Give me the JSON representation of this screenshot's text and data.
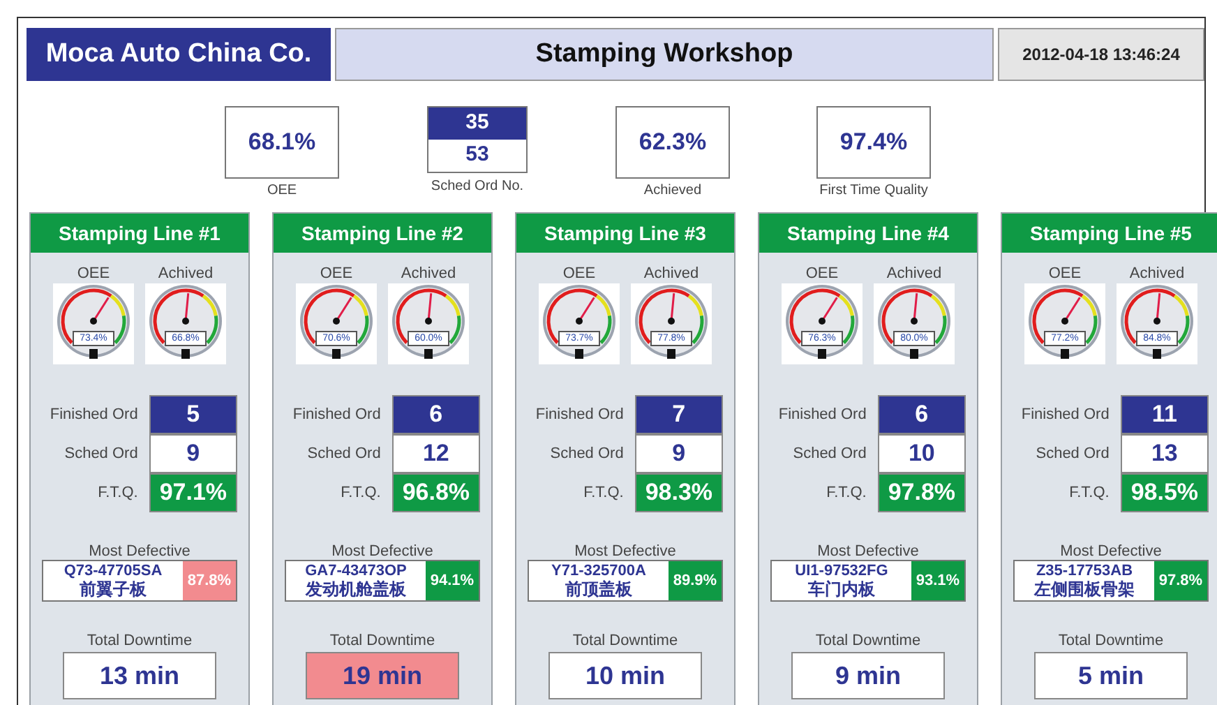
{
  "header": {
    "company": "Moca Auto China Co.",
    "title": "Stamping Workshop",
    "datetime": "2012-04-18 13:46:24"
  },
  "summary": {
    "oee": {
      "value": "68.1%",
      "label": "OEE"
    },
    "sched_ord": {
      "finished": "35",
      "scheduled": "53",
      "label": "Sched Ord No."
    },
    "achieved": {
      "value": "62.3%",
      "label": "Achieved"
    },
    "ftq": {
      "value": "97.4%",
      "label": "First Time Quality"
    }
  },
  "lines": [
    {
      "title": "Stamping Line #1",
      "gauges": [
        {
          "label": "OEE",
          "reading": "73.4%",
          "level": 0.62
        },
        {
          "label": "Achived",
          "reading": "66.8%",
          "level": 0.52
        }
      ],
      "finished_label": "Finished Ord",
      "finished": "5",
      "sched_label": "Sched Ord",
      "sched": "9",
      "ftq_label": "F.T.Q.",
      "ftq": "97.1%",
      "defective_label": "Most Defective",
      "part_no": "Q73-47705SA",
      "part_name": "前翼子板",
      "part_pct": "87.8%",
      "part_alert": true,
      "downtime_label": "Total Downtime",
      "downtime": "13 min",
      "downtime_alert": false
    },
    {
      "title": "Stamping Line #2",
      "gauges": [
        {
          "label": "OEE",
          "reading": "70.6%",
          "level": 0.62
        },
        {
          "label": "Achived",
          "reading": "60.0%",
          "level": 0.52
        }
      ],
      "finished_label": "Finished Ord",
      "finished": "6",
      "sched_label": "Sched Ord",
      "sched": "12",
      "ftq_label": "F.T.Q.",
      "ftq": "96.8%",
      "defective_label": "Most Defective",
      "part_no": "GA7-43473OP",
      "part_name": "发动机舱盖板",
      "part_pct": "94.1%",
      "part_alert": false,
      "downtime_label": "Total Downtime",
      "downtime": "19 min",
      "downtime_alert": true
    },
    {
      "title": "Stamping Line #3",
      "gauges": [
        {
          "label": "OEE",
          "reading": "73.7%",
          "level": 0.62
        },
        {
          "label": "Achived",
          "reading": "77.8%",
          "level": 0.52
        }
      ],
      "finished_label": "Finished Ord",
      "finished": "7",
      "sched_label": "Sched Ord",
      "sched": "9",
      "ftq_label": "F.T.Q.",
      "ftq": "98.3%",
      "defective_label": "Most Defective",
      "part_no": "Y71-325700A",
      "part_name": "前顶盖板",
      "part_pct": "89.9%",
      "part_alert": false,
      "downtime_label": "Total Downtime",
      "downtime": "10 min",
      "downtime_alert": false
    },
    {
      "title": "Stamping Line #4",
      "gauges": [
        {
          "label": "OEE",
          "reading": "76.3%",
          "level": 0.62
        },
        {
          "label": "Achived",
          "reading": "80.0%",
          "level": 0.52
        }
      ],
      "finished_label": "Finished Ord",
      "finished": "6",
      "sched_label": "Sched Ord",
      "sched": "10",
      "ftq_label": "F.T.Q.",
      "ftq": "97.8%",
      "defective_label": "Most Defective",
      "part_no": "UI1-97532FG",
      "part_name": "车门内板",
      "part_pct": "93.1%",
      "part_alert": false,
      "downtime_label": "Total Downtime",
      "downtime": "9 min",
      "downtime_alert": false
    },
    {
      "title": "Stamping Line #5",
      "gauges": [
        {
          "label": "OEE",
          "reading": "77.2%",
          "level": 0.62
        },
        {
          "label": "Achived",
          "reading": "84.8%",
          "level": 0.52
        }
      ],
      "finished_label": "Finished Ord",
      "finished": "11",
      "sched_label": "Sched Ord",
      "sched": "13",
      "ftq_label": "F.T.Q.",
      "ftq": "98.5%",
      "defective_label": "Most Defective",
      "part_no": "Z35-17753AB",
      "part_name": "左侧围板骨架",
      "part_pct": "97.8%",
      "part_alert": false,
      "downtime_label": "Total Downtime",
      "downtime": "5 min",
      "downtime_alert": false
    }
  ]
}
